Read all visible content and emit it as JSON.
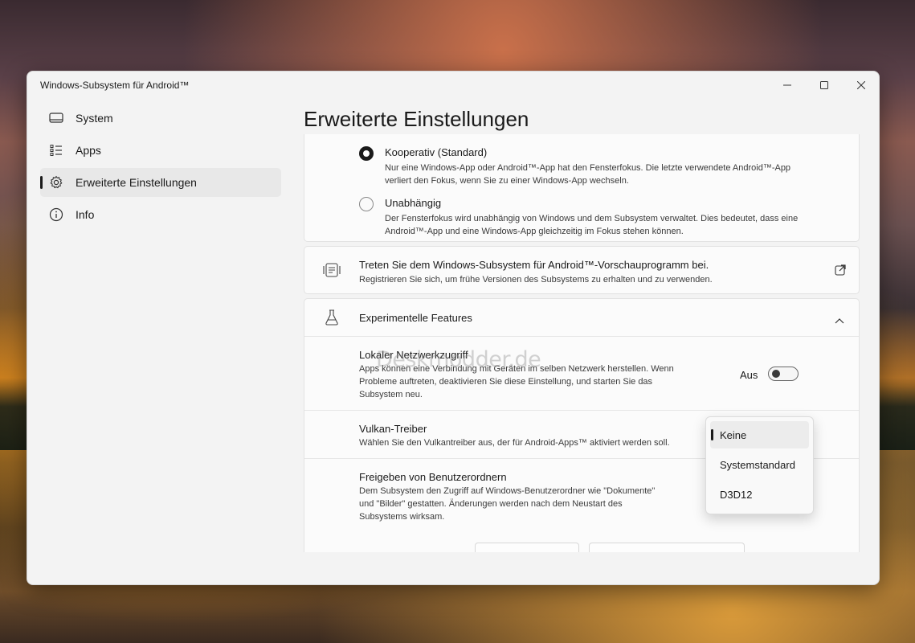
{
  "window": {
    "title": "Windows-Subsystem für Android™",
    "minimize_icon": "minimize-icon",
    "maximize_icon": "maximize-icon",
    "close_icon": "close-icon"
  },
  "sidebar": {
    "items": [
      {
        "label": "System",
        "icon": "laptop-icon"
      },
      {
        "label": "Apps",
        "icon": "list-icon"
      },
      {
        "label": "Erweiterte Einstellungen",
        "icon": "gear-icon",
        "active": true
      },
      {
        "label": "Info",
        "icon": "info-icon"
      }
    ]
  },
  "page_title": "Erweiterte Einstellungen",
  "focus_card": {
    "options": [
      {
        "title": "Kooperativ (Standard)",
        "desc": "Nur eine Windows-App oder Android™-App hat den Fensterfokus. Die letzte verwendete Android™-App verliert den Fokus, wenn Sie zu einer Windows-App wechseln.",
        "checked": true
      },
      {
        "title": "Unabhängig",
        "desc": "Der Fensterfokus wird unabhängig von Windows und dem Subsystem verwaltet. Dies bedeutet, dass eine Android™-App und eine Windows-App gleichzeitig im Fokus stehen können.",
        "checked": false
      }
    ]
  },
  "preview_card": {
    "title": "Treten Sie dem Windows-Subsystem für Android™-Vorschauprogramm bei.",
    "desc": "Registrieren Sie sich, um frühe Versionen des Subsystems zu erhalten und zu verwenden.",
    "icon": "preview-program-icon",
    "link_icon": "external-link-icon"
  },
  "experimental": {
    "title": "Experimentelle Features",
    "icon": "flask-icon",
    "chevron": "chevron-up-icon",
    "network": {
      "title": "Lokaler Netzwerkzugriff",
      "desc": "Apps können eine Verbindung mit Geräten im selben Netzwerk herstellen. Wenn Probleme auftreten, deaktivieren Sie diese Einstellung, und starten Sie das Subsystem neu.",
      "toggle_label": "Aus",
      "toggle_on": false
    },
    "vulkan": {
      "title": "Vulkan-Treiber",
      "desc": "Wählen Sie den Vulkantreiber aus, der für Android-Apps™ aktiviert werden soll."
    },
    "share": {
      "title": "Freigeben von Benutzerordnern",
      "desc": "Dem Subsystem den Zugriff auf Windows-Benutzerordner wie \"Dokumente\" und \"Bilder\" gestatten. Änderungen werden nach dem Neustart des Subsystems wirksam."
    }
  },
  "dropdown": {
    "options": [
      "Keine",
      "Systemstandard",
      "D3D12"
    ],
    "selected": "Keine"
  },
  "watermark": "Deskmodder.de"
}
